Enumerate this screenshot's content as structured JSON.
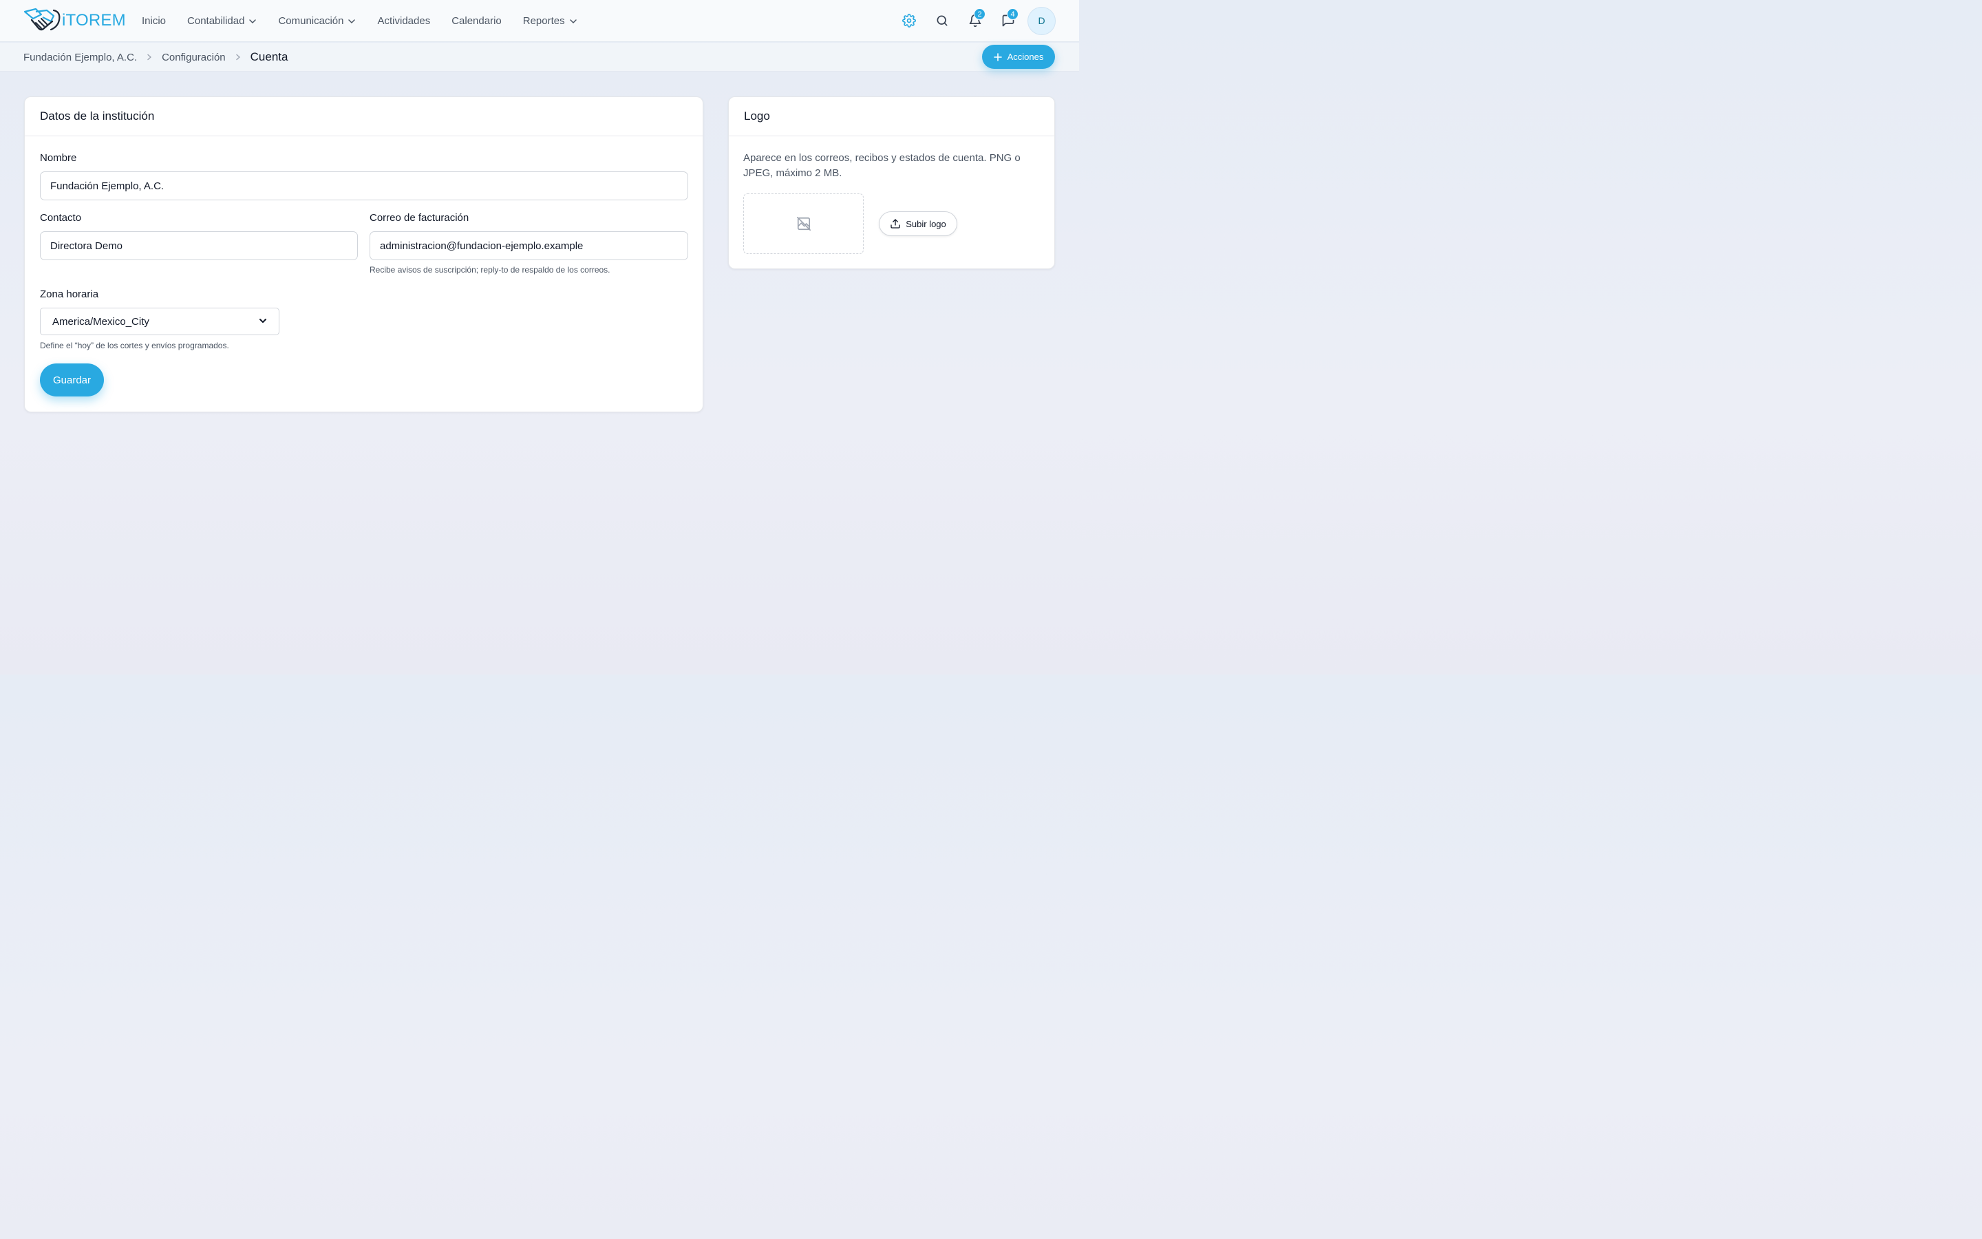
{
  "app": {
    "name": "iTOREM",
    "brand_color": "#29a9e1"
  },
  "nav": {
    "items": [
      {
        "label": "Inicio",
        "has_dropdown": false
      },
      {
        "label": "Contabilidad",
        "has_dropdown": true
      },
      {
        "label": "Comunicación",
        "has_dropdown": true
      },
      {
        "label": "Actividades",
        "has_dropdown": false
      },
      {
        "label": "Calendario",
        "has_dropdown": false
      },
      {
        "label": "Reportes",
        "has_dropdown": true
      }
    ]
  },
  "topbar": {
    "icons": [
      "gear-icon",
      "search-icon",
      "bell-icon",
      "chat-icon"
    ],
    "notifications_count": "2",
    "messages_count": "4",
    "avatar_initial": "D"
  },
  "breadcrumb": {
    "items": [
      "Fundación Ejemplo, A.C.",
      "Configuración"
    ],
    "current": "Cuenta"
  },
  "actions_button": {
    "label": "Acciones"
  },
  "institution_card": {
    "title": "Datos de la institución",
    "name_label": "Nombre",
    "name_value": "Fundación Ejemplo, A.C.",
    "contact_label": "Contacto",
    "contact_value": "Directora Demo",
    "billing_email_label": "Correo de facturación",
    "billing_email_value": "administracion@fundacion-ejemplo.example",
    "billing_email_help": "Recibe avisos de suscripción; reply-to de respaldo de los correos.",
    "timezone_label": "Zona horaria",
    "timezone_value": "America/Mexico_City",
    "timezone_help": "Define el “hoy” de los cortes y envíos programados.",
    "save_label": "Guardar"
  },
  "logo_card": {
    "title": "Logo",
    "description": "Aparece en los correos, recibos y estados de cuenta. PNG o JPEG, máximo 2 MB.",
    "placeholder_icon": "image-off-icon",
    "upload_label": "Subir logo"
  }
}
